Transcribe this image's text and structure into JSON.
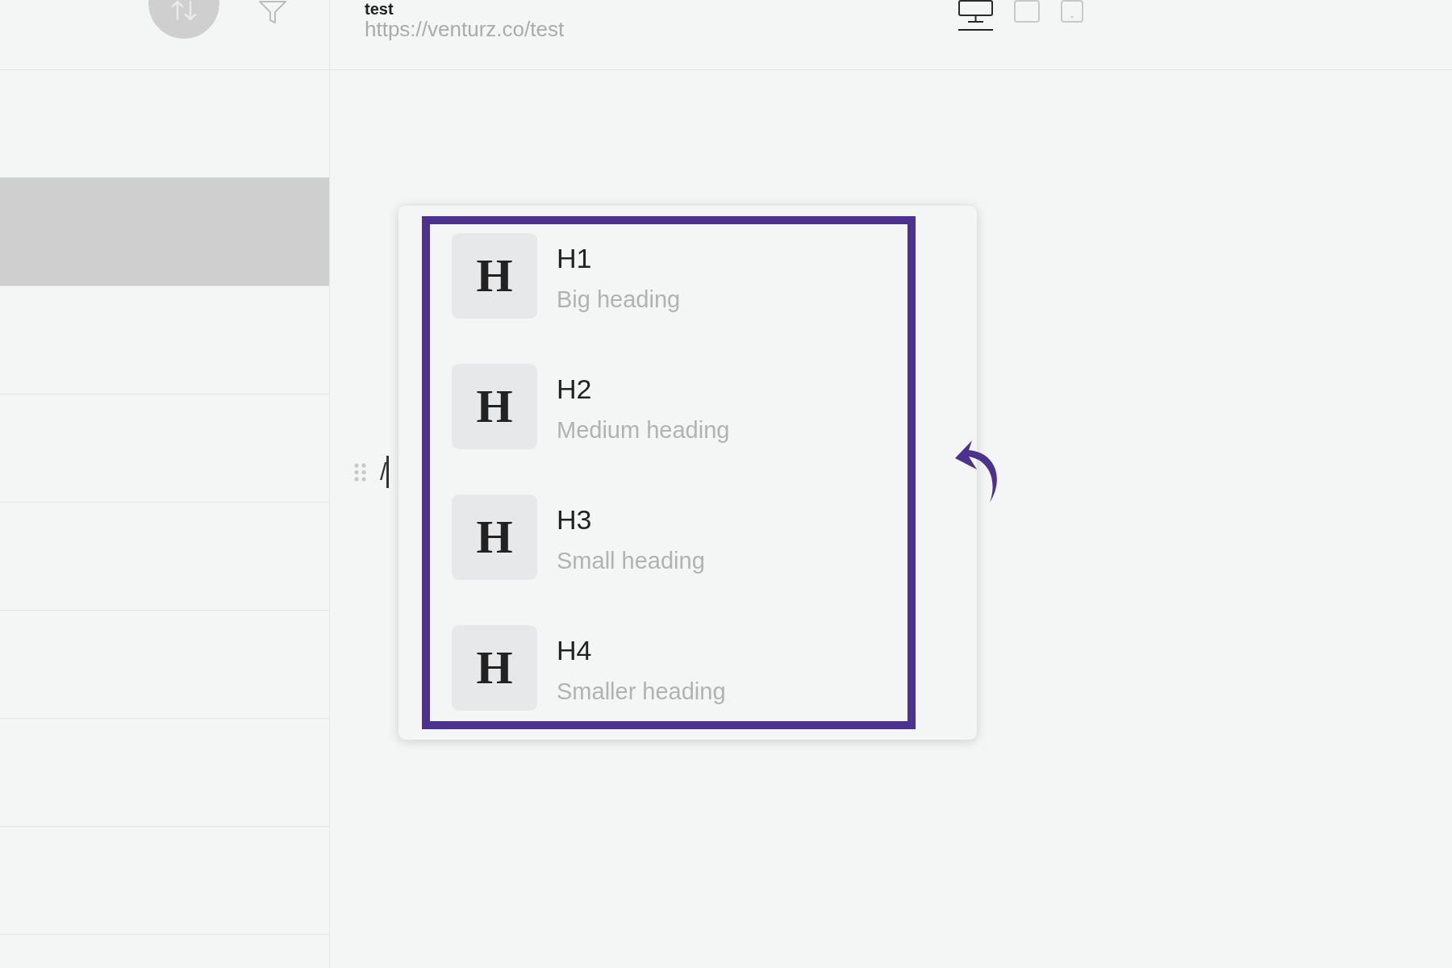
{
  "header": {
    "title": "test",
    "url": "https://venturz.co/test",
    "devices": [
      {
        "kind": "desktop",
        "selected": true
      },
      {
        "kind": "tablet",
        "selected": false
      },
      {
        "kind": "mobile",
        "selected": false
      }
    ]
  },
  "sidebar": {
    "items": [
      {
        "selected": false
      },
      {
        "selected": true
      },
      {
        "selected": false
      },
      {
        "selected": false
      },
      {
        "selected": false
      },
      {
        "selected": false
      },
      {
        "selected": false
      },
      {
        "selected": false
      },
      {
        "selected": false
      }
    ]
  },
  "editor": {
    "text": "/"
  },
  "block_menu": {
    "items": [
      {
        "glyph": "H",
        "title": "H1",
        "description": "Big heading"
      },
      {
        "glyph": "H",
        "title": "H2",
        "description": "Medium heading"
      },
      {
        "glyph": "H",
        "title": "H3",
        "description": "Small heading"
      },
      {
        "glyph": "H",
        "title": "H4",
        "description": "Smaller heading"
      }
    ]
  }
}
